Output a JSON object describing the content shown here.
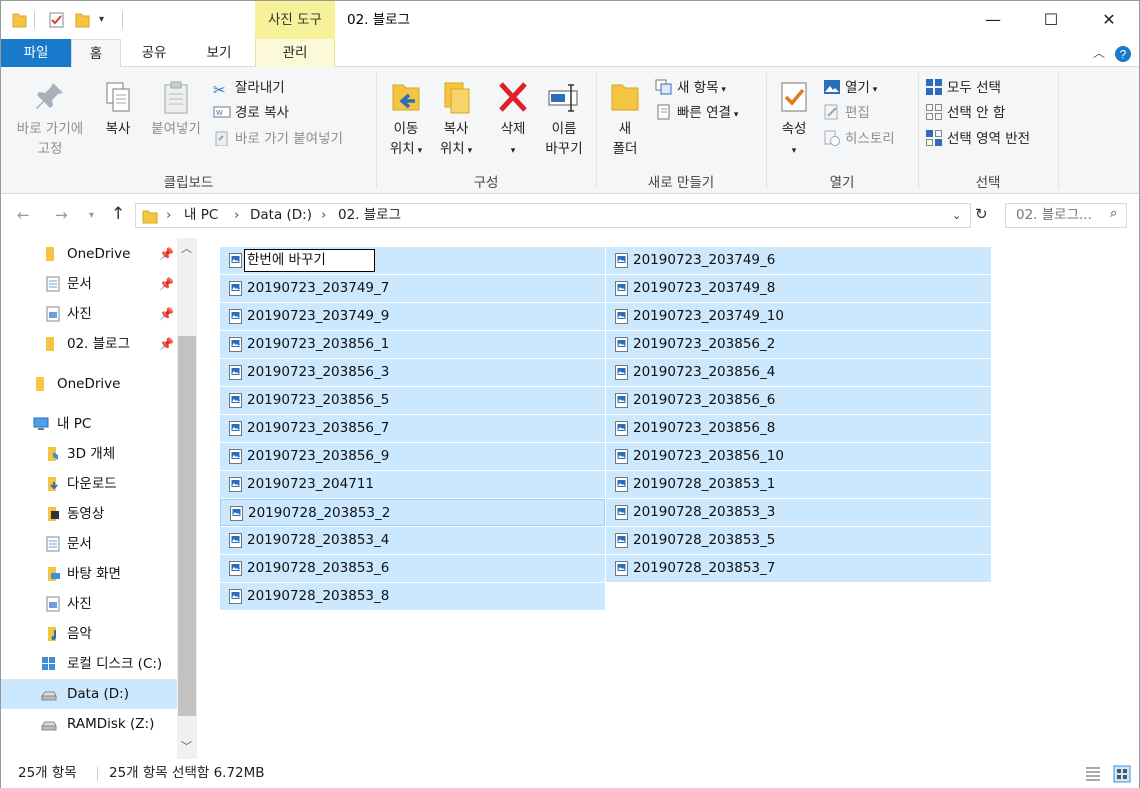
{
  "window": {
    "title": "02. 블로그",
    "context_tab_header": "사진 도구",
    "controls": {
      "minimize": "—",
      "maximize": "☐",
      "close": "✕"
    }
  },
  "tabs": [
    {
      "label": "파일"
    },
    {
      "label": "홈"
    },
    {
      "label": "공유"
    },
    {
      "label": "보기"
    },
    {
      "label": "관리"
    }
  ],
  "ribbon": {
    "clipboard": {
      "group": "클립보드",
      "pin_line1": "바로 가기에",
      "pin_line2": "고정",
      "copy": "복사",
      "paste": "붙여넣기",
      "cut": "잘라내기",
      "copy_path": "경로 복사",
      "paste_shortcut": "바로 가기 붙여넣기"
    },
    "organize": {
      "group": "구성",
      "move_line1": "이동",
      "move_line2": "위치",
      "copy_line1": "복사",
      "copy_line2": "위치",
      "delete": "삭제",
      "rename_line1": "이름",
      "rename_line2": "바꾸기"
    },
    "new": {
      "group": "새로 만들기",
      "folder_line1": "새",
      "folder_line2": "폴더",
      "new_item": "새 항목",
      "easy_access": "빠른 연결"
    },
    "open": {
      "group": "열기",
      "properties": "속성",
      "open": "열기",
      "edit": "편집",
      "history": "히스토리"
    },
    "select": {
      "group": "선택",
      "select_all": "모두 선택",
      "select_none": "선택 안 함",
      "invert": "선택 영역 반전"
    }
  },
  "address": {
    "crumbs": [
      "내 PC",
      "Data (D:)",
      "02. 블로그"
    ],
    "search_placeholder": "02. 블로그..."
  },
  "nav": {
    "quick": [
      {
        "label": "OneDrive"
      },
      {
        "label": "문서"
      },
      {
        "label": "사진"
      },
      {
        "label": "02. 블로그"
      }
    ],
    "onedrive": "OneDrive",
    "thispc": "내 PC",
    "pc_items": [
      {
        "label": "3D 개체"
      },
      {
        "label": "다운로드"
      },
      {
        "label": "동영상"
      },
      {
        "label": "문서"
      },
      {
        "label": "바탕 화면"
      },
      {
        "label": "사진"
      },
      {
        "label": "음악"
      },
      {
        "label": "로컬 디스크 (C:)"
      },
      {
        "label": "Data (D:)"
      },
      {
        "label": "RAMDisk (Z:)"
      }
    ]
  },
  "files": {
    "rename_value": "한번에 바꾸기",
    "left": [
      "",
      "20190723_203749_7",
      "20190723_203749_9",
      "20190723_203856_1",
      "20190723_203856_3",
      "20190723_203856_5",
      "20190723_203856_7",
      "20190723_203856_9",
      "20190723_204711",
      "20190728_203853_2",
      "20190728_203853_4",
      "20190728_203853_6",
      "20190728_203853_8"
    ],
    "right": [
      "20190723_203749_6",
      "20190723_203749_8",
      "20190723_203749_10",
      "20190723_203856_2",
      "20190723_203856_4",
      "20190723_203856_6",
      "20190723_203856_8",
      "20190723_203856_10",
      "20190728_203853_1",
      "20190728_203853_3",
      "20190728_203853_5",
      "20190728_203853_7"
    ]
  },
  "status": {
    "count": "25개 항목",
    "selected": "25개 항목 선택함 6.72MB"
  },
  "colors": {
    "accent": "#1979ca",
    "selection": "#cce8ff",
    "context": "#f7f19a"
  }
}
